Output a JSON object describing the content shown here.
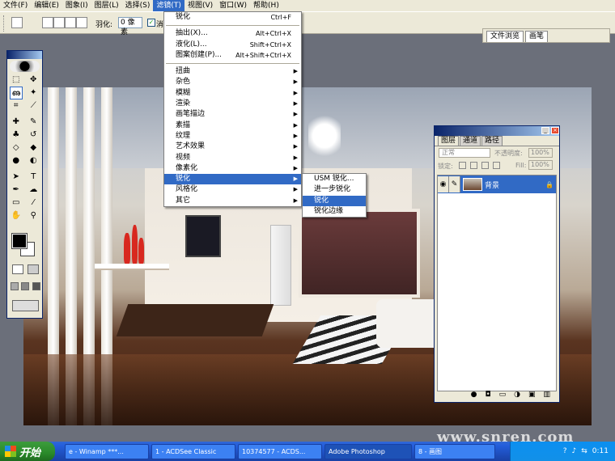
{
  "menubar": {
    "items": [
      "文件(F)",
      "编辑(E)",
      "图象(I)",
      "图层(L)",
      "选择(S)",
      "滤镜(T)",
      "视图(V)",
      "窗口(W)",
      "帮助(H)"
    ],
    "active_index": 5
  },
  "options": {
    "feather_label": "羽化:",
    "feather_value": "0 像素",
    "antialias_label": "消"
  },
  "palette_well": {
    "tabs": [
      "文件浏览",
      "画笔"
    ]
  },
  "filter_menu": {
    "top": [
      {
        "label": "锐化",
        "shortcut": "Ctrl+F"
      }
    ],
    "mid": [
      {
        "label": "抽出(X)...",
        "shortcut": "Alt+Ctrl+X"
      },
      {
        "label": "液化(L)...",
        "shortcut": "Shift+Ctrl+X"
      },
      {
        "label": "图案创建(P)...",
        "shortcut": "Alt+Shift+Ctrl+X"
      }
    ],
    "subs": [
      "扭曲",
      "杂色",
      "模糊",
      "渲染",
      "画笔描边",
      "素描",
      "纹理",
      "艺术效果",
      "视频",
      "像素化",
      "锐化",
      "风格化",
      "其它"
    ],
    "highlight_index": 10
  },
  "sharpen_submenu": {
    "items": [
      "USM 锐化...",
      "进一步锐化",
      "锐化",
      "锐化边缘"
    ],
    "highlight_index": 2
  },
  "layers_panel": {
    "tabs": [
      "图层",
      "通道",
      "路径"
    ],
    "blend_mode": "正常",
    "opacity_label": "不透明度:",
    "opacity_value": "100%",
    "lock_label": "锁定:",
    "fill_label": "Fill:",
    "fill_value": "100%",
    "layer_name": "背景"
  },
  "taskbar": {
    "start_label": "开始",
    "tasks": [
      "e - Winamp ***...",
      "1 - ACDSee Classic",
      "10374577 - ACDS...",
      "Adobe Photoshop",
      "8 - 画图"
    ],
    "active_index": 3,
    "clock": "0:11"
  },
  "watermark": "www.snren.com"
}
